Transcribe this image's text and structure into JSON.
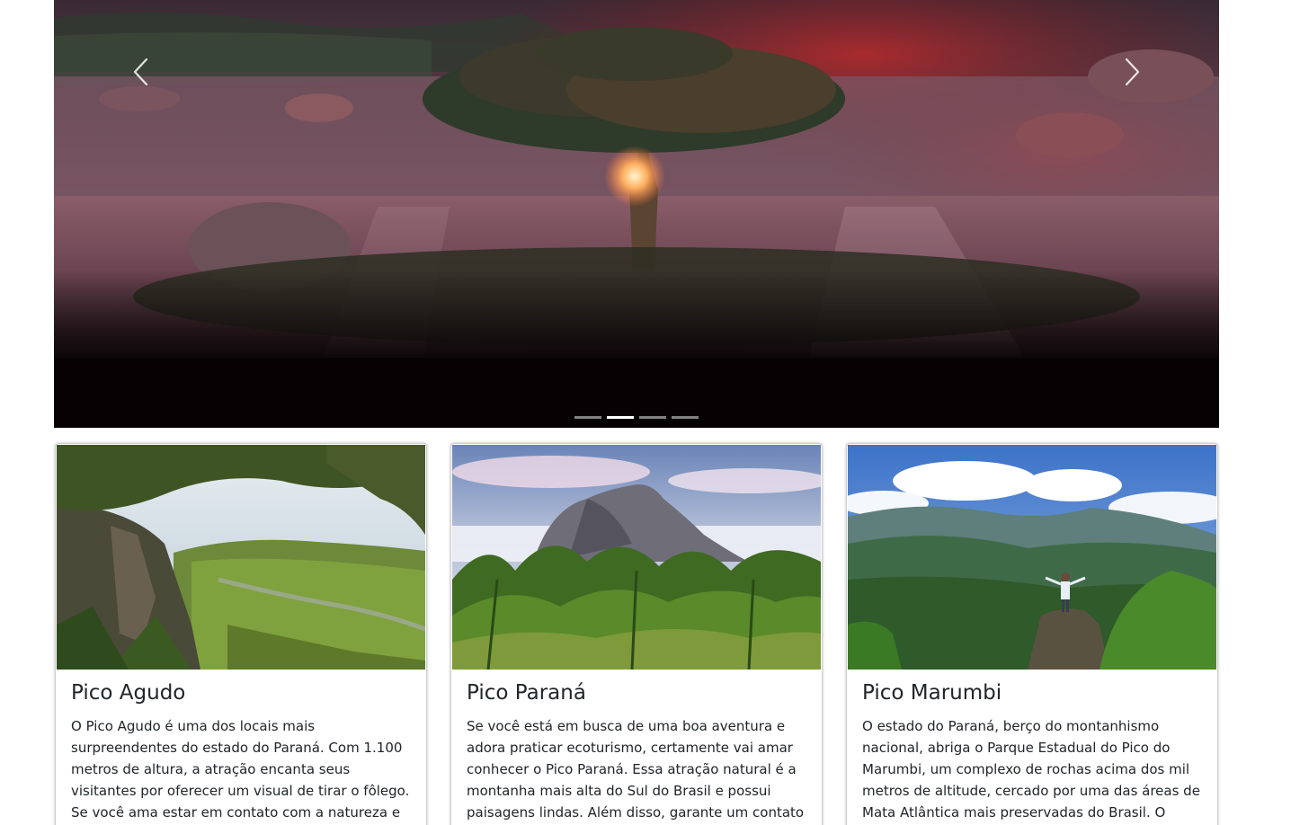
{
  "carousel": {
    "prev_icon": "chevron-left-icon",
    "next_icon": "chevron-right-icon",
    "slide_count": 4,
    "active_slide": 2,
    "indicator_color": "#ffffff"
  },
  "cards": [
    {
      "title": "Pico Agudo",
      "text": "O Pico Agudo é uma dos locais mais surpreendentes do estado do Paraná. Com 1.100 metros de altura, a atração encanta seus visitantes por oferecer um visual de tirar o fôlego. Se você ama estar em contato com a natureza e curte belas paisagens,",
      "image": "pico-agudo-landscape"
    },
    {
      "title": "Pico Paraná",
      "text": "Se você está em busca de uma boa aventura e adora praticar ecoturismo, certamente vai amar conhecer o Pico Paraná. Essa atração natural é a montanha mais alta do Sul do Brasil e possui paisagens lindas. Além disso, garante um contato único com a",
      "image": "pico-parana-landscape"
    },
    {
      "title": "Pico Marumbi",
      "text": "O estado do Paraná, berço do montanhismo nacional, abriga o Parque Estadual do Pico do Marumbi, um complexo de rochas acima dos mil metros de altitude, cercado por uma das áreas de Mata Atlântica mais preservadas do Brasil. O Parque",
      "image": "pico-marumbi-landscape"
    }
  ]
}
